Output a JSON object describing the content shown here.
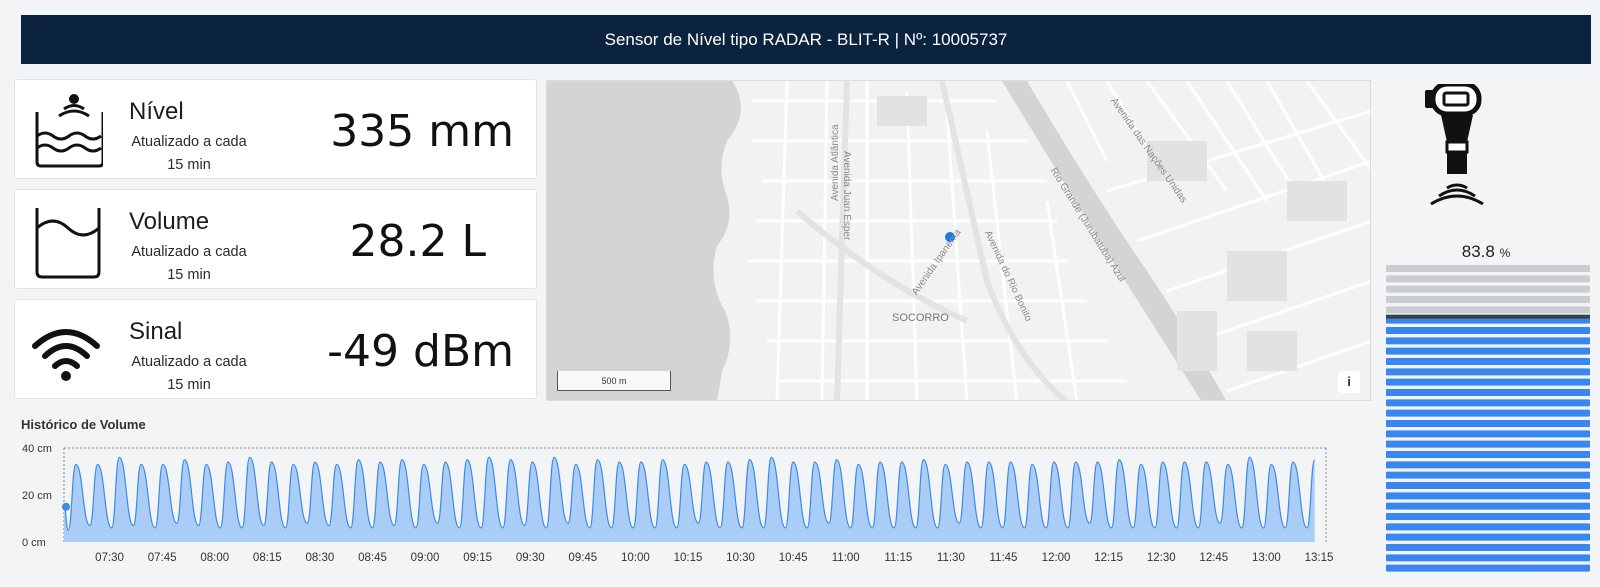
{
  "header": {
    "title": "Sensor de Nível tipo RADAR - BLIT-R | Nº: 10005737"
  },
  "cards": [
    {
      "title": "Nível",
      "subtitle": "Atualizado a cada 15 min",
      "value": "335 mm",
      "icon": "radar-level-icon"
    },
    {
      "title": "Volume",
      "subtitle": "Atualizado a cada 15 min",
      "value": "28.2 L",
      "icon": "tank-volume-icon"
    },
    {
      "title": "Sinal",
      "subtitle": "Atualizado a cada 15 min",
      "value": "-49 dBm",
      "icon": "wifi-signal-icon"
    }
  ],
  "map": {
    "scale_label": "500 m",
    "info_label": "i",
    "district_label": "SOCORRO",
    "street_labels": [
      "Avenida Atlântica",
      "Avenida Juan Esper",
      "Avenida das Nações Unidas",
      "Rio Grande (Jurubatuba) Azul",
      "Avenida Ipanema",
      "Avenida do Rio Bonito"
    ],
    "marker_color": "#1e7be6"
  },
  "gauge": {
    "percent_value": "83.8",
    "percent_unit": "%",
    "fill_fraction": 0.838,
    "water_color": "#3a86f0",
    "empty_color": "#c9ccd1"
  },
  "chart_data": {
    "type": "area",
    "title": "Histórico de Volume",
    "y_ticks": [
      "40 cm",
      "20 cm",
      "0 cm"
    ],
    "ylim": [
      0,
      40
    ],
    "x_ticks": [
      "07:30",
      "07:45",
      "08:00",
      "08:15",
      "08:30",
      "08:45",
      "09:00",
      "09:15",
      "09:30",
      "09:45",
      "10:00",
      "10:15",
      "10:30",
      "10:45",
      "11:00",
      "11:15",
      "11:30",
      "11:45",
      "12:00",
      "12:15",
      "12:30",
      "12:45",
      "13:00",
      "13:15"
    ],
    "x_range": [
      "07:17",
      "13:17"
    ],
    "period_minutes": 6.2,
    "peak_values": [
      33,
      33,
      36,
      33,
      33,
      35,
      33,
      34,
      36,
      34,
      33,
      34,
      33,
      35,
      34,
      35,
      33,
      34,
      35,
      36,
      35,
      34,
      36,
      33,
      35,
      34,
      34,
      35,
      33,
      34,
      34,
      35,
      36,
      34,
      34,
      35,
      33,
      34,
      34,
      35,
      33,
      34,
      34,
      34,
      33,
      34,
      34,
      34,
      35,
      33,
      34,
      34,
      34,
      33,
      36,
      33,
      34,
      35,
      36,
      33
    ],
    "trough_values": [
      5,
      7,
      6,
      7,
      6,
      8,
      7,
      6,
      6,
      7,
      6,
      8,
      7,
      6,
      6,
      7,
      6,
      8,
      6,
      6,
      6,
      7,
      6,
      8,
      6,
      6,
      6,
      6,
      6,
      8,
      6,
      6,
      6,
      6,
      6,
      8,
      6,
      6,
      6,
      6,
      6,
      8,
      6,
      6,
      6,
      6,
      6,
      8,
      6,
      6,
      6,
      6,
      6,
      8,
      6,
      6,
      6,
      6,
      6,
      8
    ],
    "start_value": 15,
    "grid": true,
    "fill_color": "#a9cdf7",
    "line_color": "#3d8ae6"
  }
}
